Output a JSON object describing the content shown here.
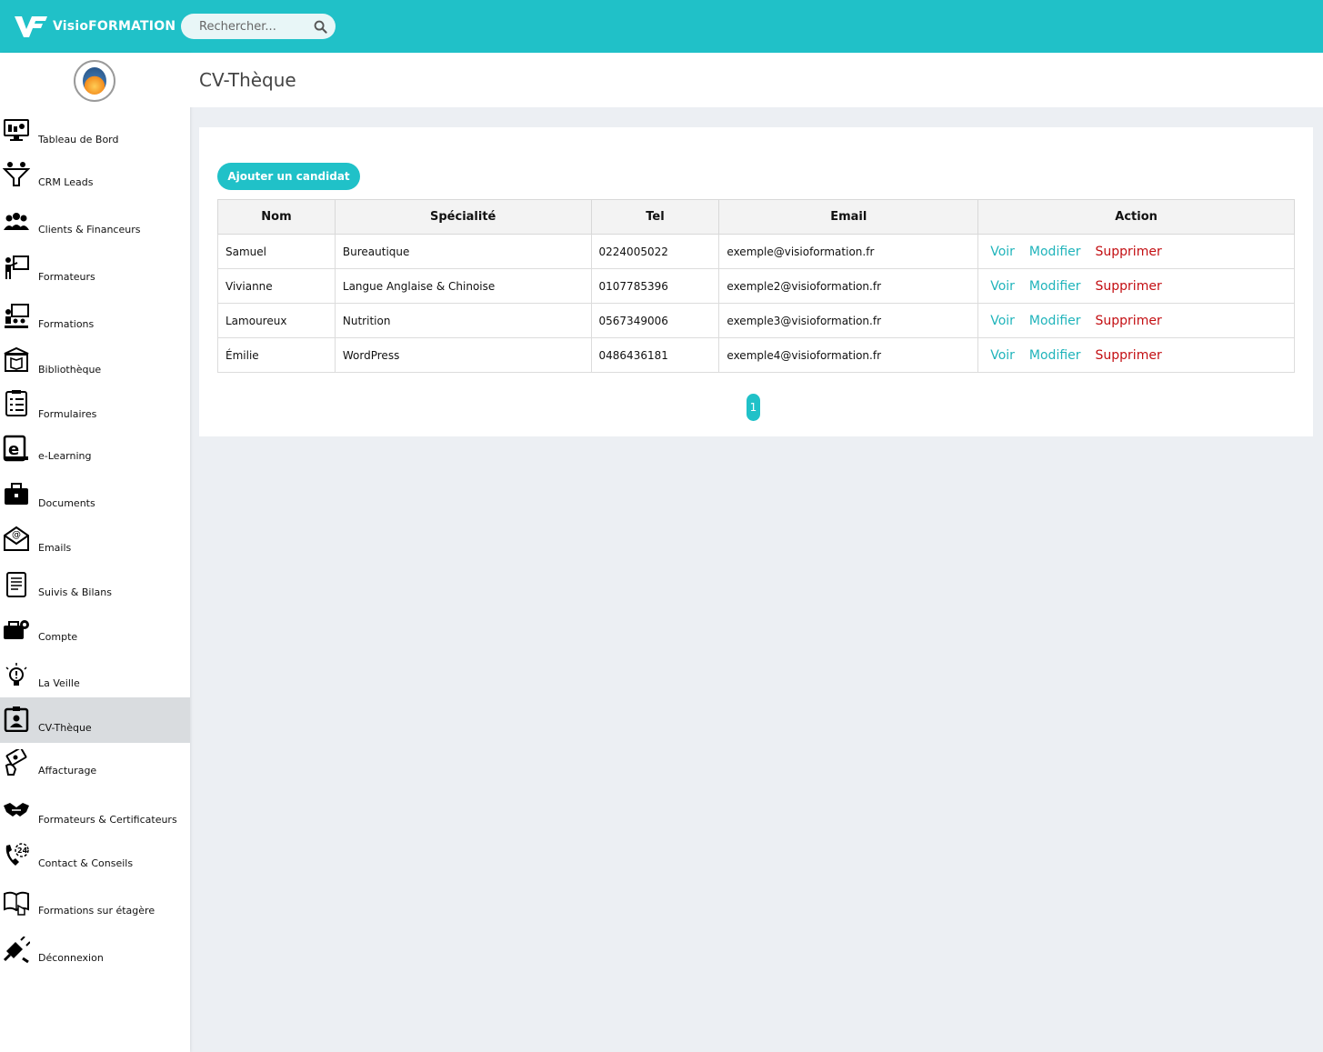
{
  "brand": {
    "name": "VisioFORMATION"
  },
  "search": {
    "placeholder": "Rechercher..."
  },
  "sidebar": {
    "items": [
      {
        "label": "Tableau de Bord",
        "icon": "dashboard-monitor-icon"
      },
      {
        "label": "CRM Leads",
        "icon": "funnel-icon"
      },
      {
        "label": "Clients & Financeurs",
        "icon": "group-icon"
      },
      {
        "label": "Formateurs",
        "icon": "teacher-board-icon"
      },
      {
        "label": "Formations",
        "icon": "classroom-icon"
      },
      {
        "label": "Bibliothèque",
        "icon": "library-icon"
      },
      {
        "label": "Formulaires",
        "icon": "checklist-icon"
      },
      {
        "label": "e-Learning",
        "icon": "elearning-book-icon"
      },
      {
        "label": "Documents",
        "icon": "briefcase-icon"
      },
      {
        "label": "Emails",
        "icon": "email-icon"
      },
      {
        "label": "Suivis & Bilans",
        "icon": "tablet-report-icon"
      },
      {
        "label": "Compte",
        "icon": "briefcase-gear-icon"
      },
      {
        "label": "La Veille",
        "icon": "lightbulb-icon"
      },
      {
        "label": "CV-Thèque",
        "icon": "id-badge-icon"
      },
      {
        "label": "Affacturage",
        "icon": "money-hand-icon"
      },
      {
        "label": "Formateurs & Certificateurs",
        "icon": "handshake-icon"
      },
      {
        "label": "Contact & Conseils",
        "icon": "phone-24-icon"
      },
      {
        "label": "Formations sur étagère",
        "icon": "book-touch-icon"
      },
      {
        "label": "Déconnexion",
        "icon": "plug-icon"
      }
    ],
    "active": "CV-Thèque"
  },
  "page": {
    "title": "CV-Thèque",
    "add_button": "Ajouter un candidat"
  },
  "table": {
    "columns": [
      "Nom",
      "Spécialité",
      "Tel",
      "Email",
      "Action"
    ],
    "rows": [
      {
        "nom": "Samuel",
        "specialite": "Bureautique",
        "tel": "0224005022",
        "email": "exemple@visioformation.fr"
      },
      {
        "nom": "Vivianne",
        "specialite": "Langue Anglaise & Chinoise",
        "tel": "0107785396",
        "email": "exemple2@visioformation.fr"
      },
      {
        "nom": "Lamoureux",
        "specialite": "Nutrition",
        "tel": "0567349006",
        "email": "exemple3@visioformation.fr"
      },
      {
        "nom": "Émilie",
        "specialite": "WordPress",
        "tel": "0486436181",
        "email": "exemple4@visioformation.fr"
      }
    ],
    "actions": {
      "view": "Voir",
      "edit": "Modifier",
      "delete": "Supprimer"
    }
  },
  "pagination": {
    "current": "1"
  },
  "colors": {
    "accent": "#20c1c8",
    "danger": "#c30e12",
    "link": "#20b4bb"
  }
}
